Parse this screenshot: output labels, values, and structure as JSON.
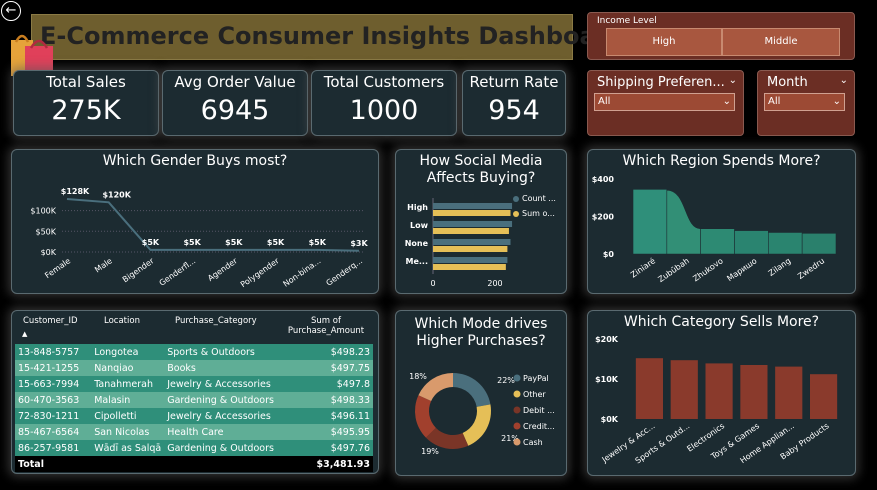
{
  "header": {
    "title": "E-Commerce Consumer Insights Dashboard"
  },
  "kpis": [
    {
      "label": "Total Sales",
      "value": "275K"
    },
    {
      "label": "Avg Order Value",
      "value": "6945"
    },
    {
      "label": "Total Customers",
      "value": "1000"
    },
    {
      "label": "Return Rate",
      "value": "954"
    }
  ],
  "slicers": {
    "income": {
      "title": "Income Level",
      "options": [
        "High",
        "Middle"
      ]
    },
    "shipping": {
      "title": "Shipping Preferen...",
      "value": "All"
    },
    "month": {
      "title": "Month",
      "value": "All"
    }
  },
  "colors": {
    "teal": "#2f8f7a",
    "brown": "#8a3a2c",
    "yellow": "#e5bf57",
    "slate": "#4a6f7d"
  },
  "gender_chart": {
    "title": "Which Gender Buys most?",
    "yticks": [
      "$100K",
      "$50K",
      "$0K"
    ],
    "chart_data": {
      "type": "line",
      "categories": [
        "Female",
        "Male",
        "Bigender",
        "Genderfl...",
        "Agender",
        "Polygender",
        "Non-bina...",
        "Genderq..."
      ],
      "values": [
        128,
        120,
        5,
        5,
        5,
        5,
        5,
        3
      ],
      "labels": [
        "$128K",
        "$120K",
        "$5K",
        "$5K",
        "$5K",
        "$5K",
        "$5K",
        "$3K"
      ],
      "ylim": [
        0,
        140
      ]
    }
  },
  "social_chart": {
    "title": "How Social Media Affects Buying?",
    "legend": [
      "Count ...",
      "Sum o..."
    ],
    "xticks": [
      "0",
      "200"
    ],
    "chart_data": {
      "type": "bar",
      "categories": [
        "High",
        "Low",
        "None",
        "Me..."
      ],
      "series": [
        {
          "name": "Count ...",
          "values": [
            255,
            255,
            250,
            240
          ]
        },
        {
          "name": "Sum o...",
          "values": [
            250,
            245,
            240,
            235
          ]
        }
      ],
      "xlim": [
        0,
        400
      ]
    }
  },
  "region_chart": {
    "title": "Which Region Spends More?",
    "yticks": [
      "$400",
      "$200",
      "$0"
    ],
    "chart_data": {
      "type": "area",
      "categories": [
        "Ziniaré",
        "Zubūbah",
        "Zhukovo",
        "Mapишo",
        "Zilang",
        "Zwedru"
      ],
      "values": [
        345,
        340,
        135,
        125,
        115,
        110
      ],
      "ylim": [
        0,
        400
      ]
    }
  },
  "table": {
    "headers": [
      "Customer_ID",
      "Location",
      "Purchase_Category",
      "Sum of Purchase_Amount"
    ],
    "rows": [
      [
        "13-848-5757",
        "Longotea",
        "Sports & Outdoors",
        "$498.23"
      ],
      [
        "15-421-1255",
        "Nanqiao",
        "Books",
        "$497.75"
      ],
      [
        "15-663-7994",
        "Tanahmerah",
        "Jewelry & Accessories",
        "$497.8"
      ],
      [
        "60-470-3563",
        "Malasin",
        "Gardening & Outdoors",
        "$498.33"
      ],
      [
        "72-830-1211",
        "Cipolletti",
        "Jewelry & Accessories",
        "$496.11"
      ],
      [
        "85-467-6564",
        "San Nicolas",
        "Health Care",
        "$495.95"
      ],
      [
        "86-257-9581",
        "Wādī as Salqā",
        "Gardening & Outdoors",
        "$497.76"
      ]
    ],
    "total_label": "Total",
    "total_value": "$3,481.93"
  },
  "mode_chart": {
    "title": "Which Mode drives Higher Purchases?",
    "chart_data": {
      "type": "pie",
      "categories": [
        "PayPal",
        "Other",
        "Debit ...",
        "Credit...",
        "Cash"
      ],
      "values": [
        22,
        21,
        19,
        19,
        18
      ],
      "labels": [
        "22%",
        "21%",
        "19%",
        "18%"
      ]
    }
  },
  "category_chart": {
    "title": "Which Category Sells More?",
    "yticks": [
      "$20K",
      "$10K",
      "$0K"
    ],
    "chart_data": {
      "type": "bar",
      "categories": [
        "Jewelry & Acc...",
        "Sports & Outd...",
        "Electronics",
        "Toys & Games",
        "Home Applian...",
        "Baby Products"
      ],
      "values": [
        15200,
        14700,
        13900,
        13500,
        13100,
        11200
      ],
      "ylim": [
        0,
        20000
      ]
    }
  }
}
